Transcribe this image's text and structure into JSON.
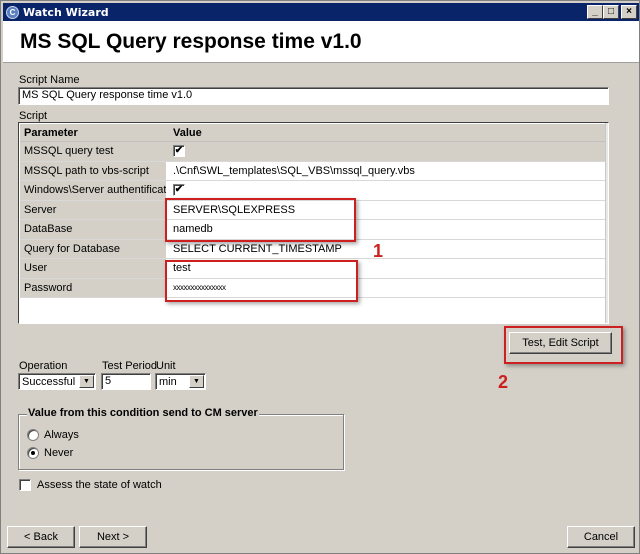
{
  "window": {
    "title": "Watch Wizard",
    "app_icon": "C",
    "controls": {
      "minimize": "_",
      "maximize": "□",
      "close": "×"
    }
  },
  "page_title": "MS SQL Query response time v1.0",
  "script_name": {
    "label": "Script Name",
    "value": "MS SQL Query response time v1.0"
  },
  "script": {
    "label": "Script",
    "columns": [
      "Parameter",
      "Value"
    ],
    "rows": [
      {
        "parameter": "MSSQL query test",
        "type": "checkbox",
        "checked": true,
        "value": "✔"
      },
      {
        "parameter": "MSSQL path to vbs-script",
        "type": "text",
        "value": ".\\Cnf\\SWL_templates\\SQL_VBS\\mssql_query.vbs"
      },
      {
        "parameter": "Windows\\Server authentification",
        "type": "checkbox",
        "checked": true,
        "value": "✔"
      },
      {
        "parameter": "Server",
        "type": "text",
        "value": "SERVER\\SQLEXPRESS"
      },
      {
        "parameter": "DataBase",
        "type": "text",
        "value": "namedb"
      },
      {
        "parameter": "Query for Database",
        "type": "text",
        "value": "SELECT CURRENT_TIMESTAMP"
      },
      {
        "parameter": "User",
        "type": "text",
        "value": "test"
      },
      {
        "parameter": "Password",
        "type": "password",
        "value": "xxxxxxxxxxxxxxx"
      }
    ]
  },
  "annotations": {
    "marker_1": "1",
    "marker_2": "2",
    "color": "#cc1f1f"
  },
  "test_edit_button": "Test, Edit Script",
  "operation": {
    "label": "Operation",
    "selected": "Successful"
  },
  "test_period": {
    "label": "Test Period",
    "value": "5"
  },
  "unit": {
    "label": "Unit",
    "selected": "min"
  },
  "send_group": {
    "legend": "Value from this condition send to CM server",
    "options": [
      {
        "label": "Always",
        "selected": false
      },
      {
        "label": "Never",
        "selected": true
      }
    ]
  },
  "assess_state": {
    "label": "Assess the state of watch",
    "checked": false
  },
  "footer": {
    "back": "< Back",
    "next": "Next >",
    "cancel": "Cancel"
  },
  "colors": {
    "titlebar": "#0a246a",
    "face": "#d4d0c8"
  }
}
